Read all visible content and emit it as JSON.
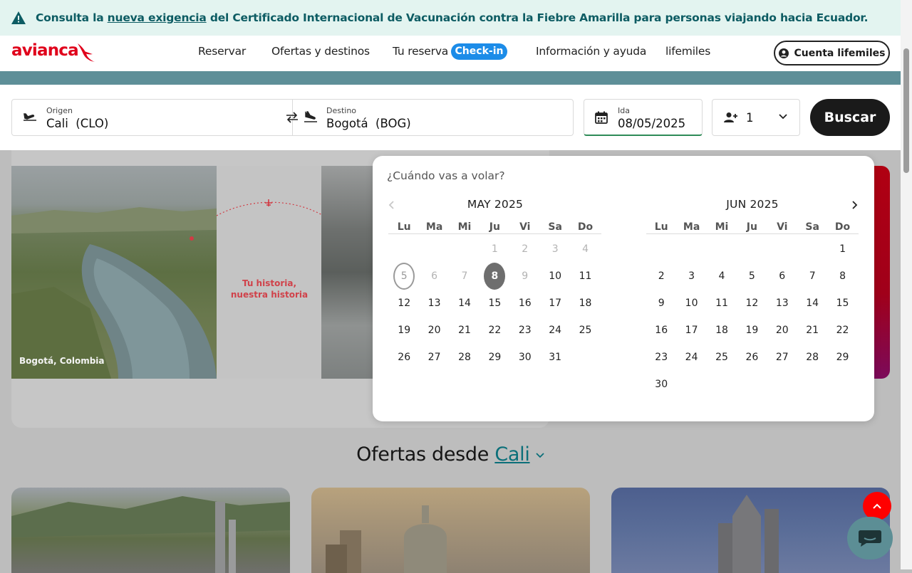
{
  "alert": {
    "prefix": "Consulta la ",
    "link": "nueva exigencia",
    "suffix": " del Certificado Internacional de Vacunación contra la Fiebre Amarilla para personas viajando hacia Ecuador."
  },
  "header": {
    "logo": "avianca",
    "nav": [
      "Reservar",
      "Ofertas y destinos",
      "Tu reserva",
      "Información y ayuda",
      "lifemiles"
    ],
    "checkin_badge": "Check-in",
    "account_label": "Cuenta lifemiles"
  },
  "search": {
    "origin_label": "Origen",
    "origin_value": "Cali  (CLO)",
    "destination_label": "Destino",
    "destination_value": "Bogotá  (BOG)",
    "date_label": "Ida",
    "date_value": "08/05/2025",
    "passengers": "1",
    "search_button": "Buscar"
  },
  "hero": {
    "tagline": "Tu historia, nuestra historia",
    "photo_caption": "Bogotá, Colombia"
  },
  "calendar": {
    "question": "¿Cuándo vas a volar?",
    "weekdays": [
      "Lu",
      "Ma",
      "Mi",
      "Ju",
      "Vi",
      "Sa",
      "Do"
    ],
    "months": [
      {
        "title": "MAY 2025",
        "offset": 3,
        "days": 31,
        "today": 5,
        "selected": 8,
        "first_enabled": 10
      },
      {
        "title": "JUN 2025",
        "offset": 6,
        "days": 30,
        "today": null,
        "selected": null,
        "first_enabled": 1
      }
    ]
  },
  "offers": {
    "title": "Ofertas desde",
    "city": "Cali"
  },
  "colors": {
    "brand_red": "#e0001b",
    "teal": "#0d5c63",
    "checkin_blue": "#1c8ce8"
  }
}
